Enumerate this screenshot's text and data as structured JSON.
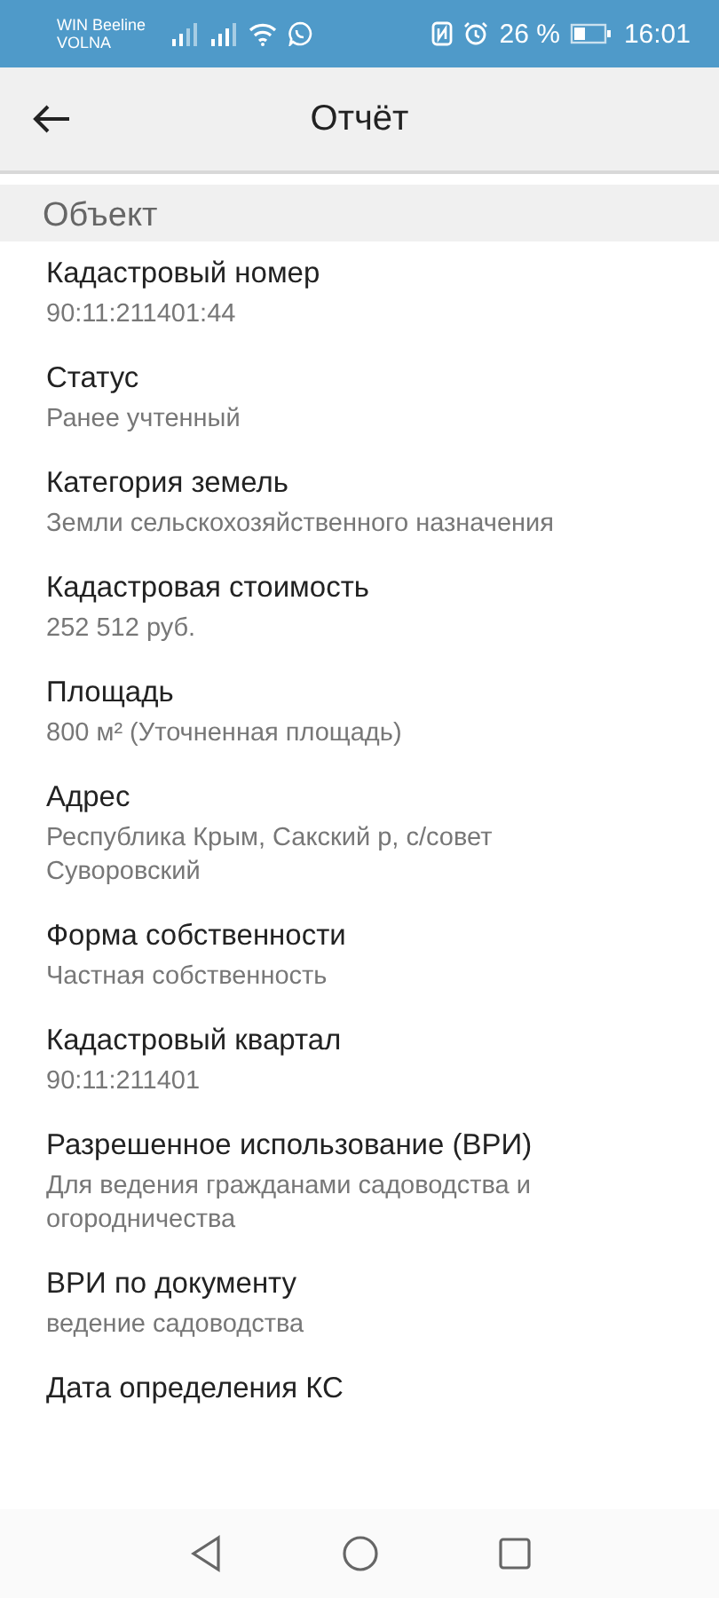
{
  "status_bar": {
    "carrier_1": "WIN Beeline",
    "carrier_2": "VOLNA",
    "battery_percent": "26 %",
    "time": "16:01"
  },
  "app_bar": {
    "title": "Отчёт"
  },
  "section": {
    "title": "Объект"
  },
  "fields": [
    {
      "label": "Кадастровый номер",
      "value": "90:11:211401:44"
    },
    {
      "label": "Статус",
      "value": "Ранее учтенный"
    },
    {
      "label": "Категория земель",
      "value": "Земли сельскохозяйственного назначения"
    },
    {
      "label": "Кадастровая стоимость",
      "value": "252 512 руб."
    },
    {
      "label": "Площадь",
      "value": "800 м² (Уточненная площадь)"
    },
    {
      "label": "Адрес",
      "value": "Республика Крым, Сакский р, с/совет Суворовский"
    },
    {
      "label": "Форма собственности",
      "value": "Частная собственность"
    },
    {
      "label": "Кадастровый квартал",
      "value": "90:11:211401"
    },
    {
      "label": "Разрешенное использование (ВРИ)",
      "value": "Для ведения гражданами садоводства и огородничества"
    },
    {
      "label": "ВРИ по документу",
      "value": "ведение садоводства"
    },
    {
      "label": "Дата определения КС"
    }
  ]
}
